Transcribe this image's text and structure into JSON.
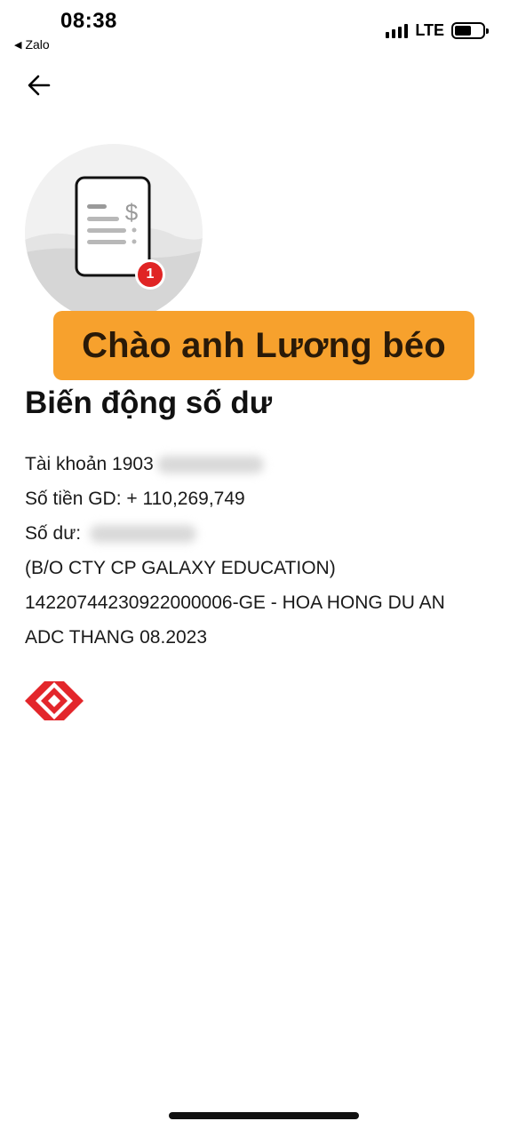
{
  "status_bar": {
    "time": "08:38",
    "back_app": "Zalo",
    "network": "LTE"
  },
  "header": {
    "back_icon": "arrow-left-icon"
  },
  "illustration": {
    "icon": "receipt-dollar-icon",
    "badge_count": "1"
  },
  "greeting": {
    "text": "Chào anh Lương béo",
    "color": "#f7a12d"
  },
  "title": "Biến động số dư",
  "details": {
    "account_label": "Tài khoản 1903",
    "amount_label": "Số tiền GD: + 110,269,749",
    "balance_label": "Số dư:",
    "line_company": "(B/O CTY CP GALAXY EDUCATION)",
    "line_ref": "14220744230922000006-GE - HOA HONG DU AN",
    "line_month": "ADC THANG 08.2023"
  },
  "bank_logo": {
    "icon": "techcombank-logo-icon",
    "color": "#e3262b"
  }
}
